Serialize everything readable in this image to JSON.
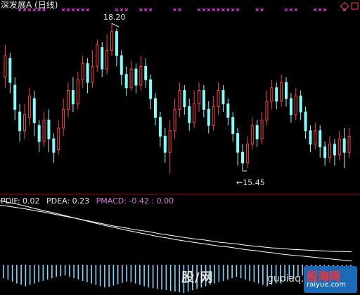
{
  "header": {
    "title": "深发展A (日线)"
  },
  "indicator": {
    "pdif": "PDIF: 0.02",
    "pdea": "PDEA: 0.23",
    "pmacd": "PMACD: -0.42 : 0.00"
  },
  "annotations": {
    "high": "18.20",
    "low": "←15.45"
  },
  "watermark": {
    "left_text": "股/网",
    "url": "gupiaq.com",
    "badge_cn": "股海网",
    "badge_url": "raiyue.com"
  },
  "colors": {
    "up": "#ff4040",
    "down": "#80ffff",
    "signal": "#ff40ff",
    "divider": "#a00000",
    "macd_line": "#ffffff",
    "hist": "#7fd8ff"
  },
  "chart_data": [
    {
      "type": "candlestick",
      "title": "深发展A (日线)",
      "ylim": [
        15.2,
        18.4
      ],
      "annotations": [
        {
          "label": "18.20",
          "value": 18.2
        },
        {
          "label": "←15.45",
          "value": 15.45
        }
      ],
      "candles": [
        {
          "o": 17.2,
          "c": 17.6,
          "h": 17.8,
          "l": 17.0
        },
        {
          "o": 17.55,
          "c": 17.1,
          "h": 17.65,
          "l": 16.9
        },
        {
          "o": 17.05,
          "c": 16.6,
          "h": 17.2,
          "l": 16.4
        },
        {
          "o": 16.55,
          "c": 16.2,
          "h": 16.7,
          "l": 16.0
        },
        {
          "o": 16.2,
          "c": 16.5,
          "h": 16.7,
          "l": 16.05
        },
        {
          "o": 16.45,
          "c": 16.85,
          "h": 17.0,
          "l": 16.3
        },
        {
          "o": 16.8,
          "c": 16.35,
          "h": 16.95,
          "l": 16.1
        },
        {
          "o": 16.3,
          "c": 16.0,
          "h": 16.4,
          "l": 15.8
        },
        {
          "o": 16.0,
          "c": 16.4,
          "h": 16.55,
          "l": 15.9
        },
        {
          "o": 16.4,
          "c": 16.05,
          "h": 16.6,
          "l": 15.8
        },
        {
          "o": 16.05,
          "c": 15.8,
          "h": 16.15,
          "l": 15.6
        },
        {
          "o": 15.85,
          "c": 16.25,
          "h": 16.4,
          "l": 15.75
        },
        {
          "o": 16.25,
          "c": 16.6,
          "h": 16.8,
          "l": 16.1
        },
        {
          "o": 16.6,
          "c": 16.95,
          "h": 17.1,
          "l": 16.45
        },
        {
          "o": 16.95,
          "c": 16.7,
          "h": 17.2,
          "l": 16.55
        },
        {
          "o": 16.7,
          "c": 17.15,
          "h": 17.3,
          "l": 16.6
        },
        {
          "o": 17.15,
          "c": 17.45,
          "h": 17.6,
          "l": 17.0
        },
        {
          "o": 17.45,
          "c": 17.1,
          "h": 17.55,
          "l": 16.9
        },
        {
          "o": 17.1,
          "c": 17.4,
          "h": 17.7,
          "l": 17.0
        },
        {
          "o": 17.4,
          "c": 17.8,
          "h": 17.9,
          "l": 17.3
        },
        {
          "o": 17.75,
          "c": 17.35,
          "h": 17.85,
          "l": 17.2
        },
        {
          "o": 17.35,
          "c": 17.7,
          "h": 18.0,
          "l": 17.25
        },
        {
          "o": 17.7,
          "c": 18.05,
          "h": 18.2,
          "l": 17.6
        },
        {
          "o": 18.05,
          "c": 17.6,
          "h": 18.1,
          "l": 17.4
        },
        {
          "o": 17.6,
          "c": 17.25,
          "h": 17.7,
          "l": 17.05
        },
        {
          "o": 17.25,
          "c": 17.0,
          "h": 17.4,
          "l": 16.85
        },
        {
          "o": 17.0,
          "c": 17.35,
          "h": 17.5,
          "l": 16.95
        },
        {
          "o": 17.35,
          "c": 17.05,
          "h": 17.45,
          "l": 16.9
        },
        {
          "o": 17.05,
          "c": 17.4,
          "h": 17.6,
          "l": 16.95
        },
        {
          "o": 17.4,
          "c": 17.15,
          "h": 17.55,
          "l": 17.0
        },
        {
          "o": 17.15,
          "c": 16.8,
          "h": 17.25,
          "l": 16.6
        },
        {
          "o": 16.8,
          "c": 16.45,
          "h": 16.9,
          "l": 16.3
        },
        {
          "o": 16.45,
          "c": 16.1,
          "h": 16.55,
          "l": 15.9
        },
        {
          "o": 16.1,
          "c": 15.8,
          "h": 16.25,
          "l": 15.6
        },
        {
          "o": 15.8,
          "c": 16.2,
          "h": 16.4,
          "l": 15.4
        },
        {
          "o": 16.2,
          "c": 16.6,
          "h": 16.8,
          "l": 16.05
        },
        {
          "o": 16.6,
          "c": 16.95,
          "h": 17.1,
          "l": 16.45
        },
        {
          "o": 16.95,
          "c": 16.65,
          "h": 17.05,
          "l": 16.5
        },
        {
          "o": 16.65,
          "c": 16.35,
          "h": 16.8,
          "l": 16.2
        },
        {
          "o": 16.35,
          "c": 16.7,
          "h": 16.95,
          "l": 16.25
        },
        {
          "o": 16.7,
          "c": 16.95,
          "h": 17.1,
          "l": 16.55
        },
        {
          "o": 16.95,
          "c": 16.6,
          "h": 17.05,
          "l": 16.45
        },
        {
          "o": 16.6,
          "c": 16.3,
          "h": 16.75,
          "l": 16.15
        },
        {
          "o": 16.3,
          "c": 16.65,
          "h": 16.85,
          "l": 16.2
        },
        {
          "o": 16.65,
          "c": 16.95,
          "h": 17.1,
          "l": 16.5
        },
        {
          "o": 16.95,
          "c": 16.7,
          "h": 17.05,
          "l": 16.55
        },
        {
          "o": 16.7,
          "c": 16.45,
          "h": 16.8,
          "l": 16.3
        },
        {
          "o": 16.45,
          "c": 16.15,
          "h": 16.55,
          "l": 16.0
        },
        {
          "o": 16.15,
          "c": 15.8,
          "h": 16.25,
          "l": 15.55
        },
        {
          "o": 15.8,
          "c": 15.6,
          "h": 15.95,
          "l": 15.45
        },
        {
          "o": 15.6,
          "c": 15.95,
          "h": 16.1,
          "l": 15.5
        },
        {
          "o": 15.95,
          "c": 16.3,
          "h": 16.45,
          "l": 15.85
        },
        {
          "o": 16.3,
          "c": 16.05,
          "h": 16.4,
          "l": 15.9
        },
        {
          "o": 16.05,
          "c": 16.4,
          "h": 16.55,
          "l": 15.95
        },
        {
          "o": 16.4,
          "c": 16.75,
          "h": 16.95,
          "l": 16.3
        },
        {
          "o": 16.75,
          "c": 17.0,
          "h": 17.15,
          "l": 16.6
        },
        {
          "o": 17.0,
          "c": 16.75,
          "h": 17.1,
          "l": 16.6
        },
        {
          "o": 16.75,
          "c": 17.1,
          "h": 17.25,
          "l": 16.65
        },
        {
          "o": 17.1,
          "c": 16.8,
          "h": 17.2,
          "l": 16.65
        },
        {
          "o": 16.8,
          "c": 16.5,
          "h": 16.9,
          "l": 16.35
        },
        {
          "o": 16.5,
          "c": 16.85,
          "h": 17.0,
          "l": 16.4
        },
        {
          "o": 16.85,
          "c": 16.55,
          "h": 16.95,
          "l": 16.4
        },
        {
          "o": 16.55,
          "c": 16.2,
          "h": 16.65,
          "l": 16.05
        },
        {
          "o": 16.2,
          "c": 15.95,
          "h": 16.3,
          "l": 15.8
        },
        {
          "o": 15.95,
          "c": 16.2,
          "h": 16.35,
          "l": 15.85
        },
        {
          "o": 16.2,
          "c": 15.9,
          "h": 16.3,
          "l": 15.7
        },
        {
          "o": 15.9,
          "c": 15.7,
          "h": 16.0,
          "l": 15.55
        },
        {
          "o": 15.7,
          "c": 15.95,
          "h": 16.1,
          "l": 15.6
        },
        {
          "o": 15.95,
          "c": 15.75,
          "h": 16.05,
          "l": 15.55
        },
        {
          "o": 15.75,
          "c": 16.05,
          "h": 16.2,
          "l": 15.65
        },
        {
          "o": 16.05,
          "c": 15.8,
          "h": 16.25,
          "l": 15.5
        },
        {
          "o": 15.8,
          "c": 16.1,
          "h": 16.25,
          "l": 15.7
        }
      ],
      "signal_markers": [
        3,
        4,
        5,
        6,
        7,
        8,
        12,
        13,
        14,
        15,
        16,
        17,
        23,
        24,
        25,
        28,
        29,
        30,
        35,
        36,
        40,
        41,
        42,
        43,
        44,
        45,
        46,
        47,
        48,
        52,
        53,
        58,
        59,
        60,
        64,
        65,
        66,
        70
      ]
    },
    {
      "type": "line",
      "series": [
        {
          "name": "PDIF",
          "values": [
            1.4,
            1.36,
            1.32,
            1.27,
            1.22,
            1.17,
            1.13,
            1.08,
            1.03,
            0.98,
            0.93,
            0.88,
            0.83,
            0.79,
            0.74,
            0.7,
            0.66,
            0.62,
            0.58,
            0.55,
            0.51,
            0.48,
            0.45,
            0.42,
            0.39,
            0.36,
            0.34,
            0.31,
            0.28,
            0.26,
            0.23,
            0.21,
            0.18,
            0.16,
            0.14,
            0.12,
            0.1,
            0.08,
            0.06,
            0.04,
            0.02
          ]
        },
        {
          "name": "PDEA",
          "values": [
            1.3,
            1.27,
            1.24,
            1.21,
            1.17,
            1.14,
            1.1,
            1.06,
            1.02,
            0.98,
            0.94,
            0.9,
            0.86,
            0.82,
            0.79,
            0.75,
            0.72,
            0.69,
            0.65,
            0.62,
            0.59,
            0.56,
            0.53,
            0.51,
            0.48,
            0.45,
            0.43,
            0.41,
            0.38,
            0.36,
            0.34,
            0.32,
            0.31,
            0.29,
            0.28,
            0.27,
            0.26,
            0.25,
            0.24,
            0.24,
            0.23
          ]
        }
      ],
      "histogram": {
        "name": "PMACD",
        "values": [
          -0.2,
          -0.22,
          -0.25,
          -0.28,
          -0.3,
          -0.32,
          -0.3,
          -0.28,
          -0.26,
          -0.24,
          -0.22,
          -0.2,
          -0.18,
          -0.17,
          -0.16,
          -0.18,
          -0.2,
          -0.22,
          -0.24,
          -0.26,
          -0.28,
          -0.3,
          -0.32,
          -0.34,
          -0.33,
          -0.31,
          -0.29,
          -0.27,
          -0.25,
          -0.26,
          -0.28,
          -0.3,
          -0.32,
          -0.34,
          -0.35,
          -0.36,
          -0.37,
          -0.38,
          -0.39,
          -0.4,
          -0.41,
          -0.42,
          -0.4,
          -0.38,
          -0.36,
          -0.34,
          -0.32,
          -0.3,
          -0.28,
          -0.26,
          -0.24,
          -0.22,
          -0.2,
          -0.18,
          -0.2,
          -0.22,
          -0.24,
          -0.26,
          -0.28,
          -0.3,
          -0.32,
          -0.3,
          -0.28,
          -0.26,
          -0.24,
          -0.22,
          -0.2,
          -0.18,
          -0.16,
          -0.14,
          -0.12,
          -0.1,
          -0.08,
          -0.06,
          -0.05,
          -0.04,
          -0.03,
          -0.03,
          -0.02,
          -0.02
        ]
      }
    }
  ]
}
